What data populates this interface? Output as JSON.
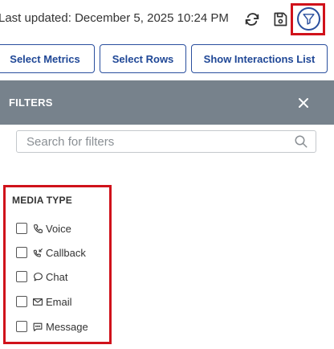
{
  "header": {
    "last_updated": "Last updated: December 5, 2025 10:24 PM",
    "icons": {
      "refresh": "refresh-icon",
      "save": "save-icon",
      "filter": "filter-icon"
    },
    "accent": "#2a4f9e",
    "highlight": "#d0121b"
  },
  "toolbar": {
    "select_metrics": "Select Metrics",
    "select_rows": "Select Rows",
    "show_interactions": "Show Interactions List"
  },
  "filters_panel": {
    "title": "FILTERS",
    "header_color": "#77828c",
    "search_placeholder": "Search for filters",
    "media_type": {
      "title": "MEDIA TYPE",
      "options": [
        {
          "label": "Voice",
          "icon": "phone-icon",
          "checked": false
        },
        {
          "label": "Callback",
          "icon": "callback-icon",
          "checked": false
        },
        {
          "label": "Chat",
          "icon": "chat-bubble-icon",
          "checked": false
        },
        {
          "label": "Email",
          "icon": "envelope-icon",
          "checked": false
        },
        {
          "label": "Message",
          "icon": "message-icon",
          "checked": false
        }
      ]
    }
  }
}
